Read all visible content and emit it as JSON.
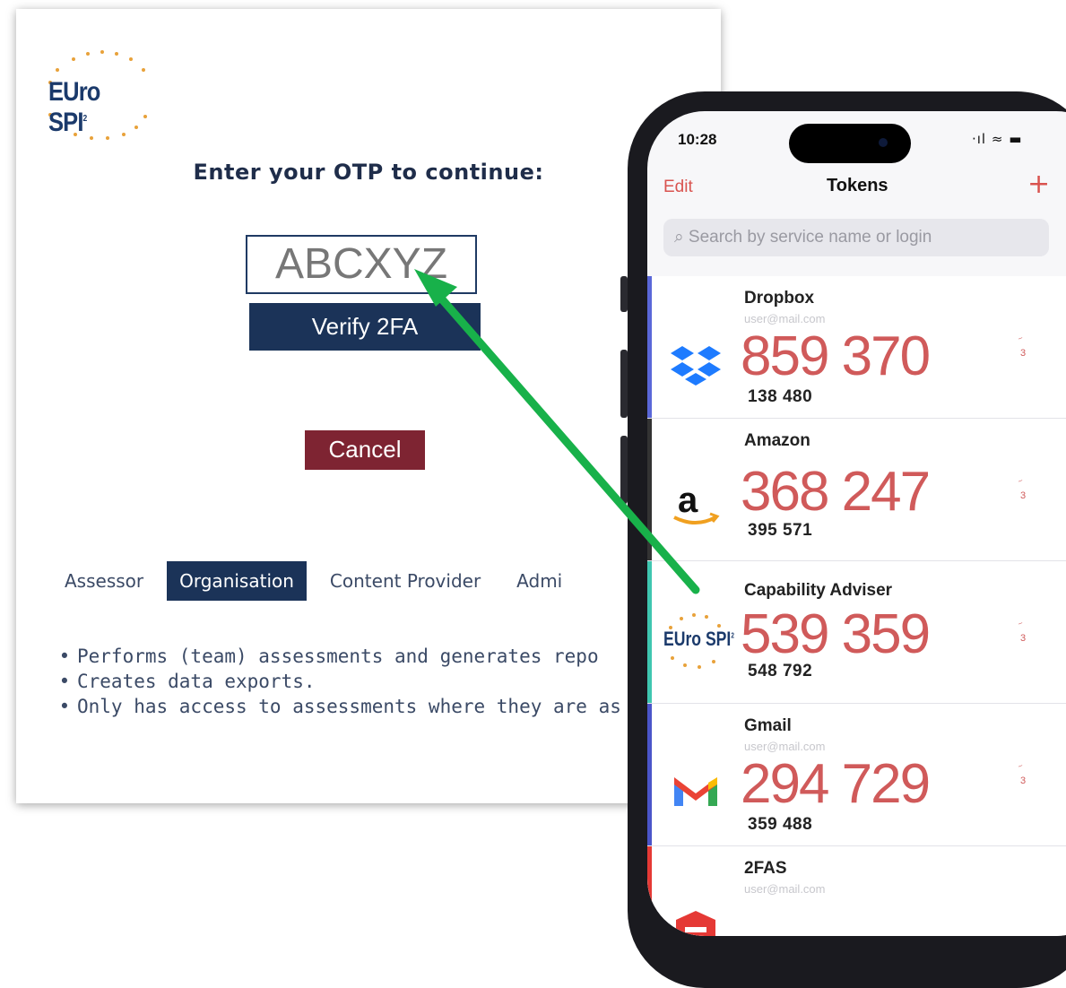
{
  "web": {
    "logo_text": "EUro SPI",
    "logo_sup": "2",
    "title": "Enter your OTP to continue:",
    "otp_value": "ABCXYZ",
    "verify_label": "Verify 2FA",
    "cancel_label": "Cancel",
    "tabs": [
      {
        "label": "Assessor",
        "active": false
      },
      {
        "label": "Organisation",
        "active": true
      },
      {
        "label": "Content Provider",
        "active": false
      },
      {
        "label": "Admi",
        "active": false
      }
    ],
    "bullets": [
      "Performs (team) assessments and generates repo",
      "Creates data exports.",
      "Only has access to assessments where they are as"
    ]
  },
  "phone": {
    "time": "10:28",
    "signal": "·ıl ≈ ▬",
    "edit_label": "Edit",
    "title": "Tokens",
    "add_label": "+",
    "search_placeholder": "Search by service name or login",
    "tokens": [
      {
        "service": "Dropbox",
        "login": "user@mail.com",
        "code": "859 370",
        "next": "138 480",
        "timer": "3",
        "accent": "#5a67d8",
        "icon": "dropbox-icon"
      },
      {
        "service": "Amazon",
        "login": "",
        "code": "368 247",
        "next": "395 571",
        "timer": "3",
        "accent": "#333333",
        "icon": "amazon-icon"
      },
      {
        "service": "Capability Adviser",
        "login": "",
        "code": "539 359",
        "next": "548 792",
        "timer": "3",
        "accent": "#3fc6b0",
        "icon": "eurospi-icon"
      },
      {
        "service": "Gmail",
        "login": "user@mail.com",
        "code": "294 729",
        "next": "359 488",
        "timer": "3",
        "accent": "#4a55c9",
        "icon": "gmail-icon"
      },
      {
        "service": "2FAS",
        "login": "user@mail.com",
        "code": "",
        "next": "",
        "timer": "",
        "accent": "#e53935",
        "icon": "2fas-icon"
      }
    ]
  },
  "colors": {
    "navy": "#1b3358",
    "cancel": "#7e2432",
    "token_red": "#d05a5a",
    "arrow_green": "#18b14a"
  }
}
